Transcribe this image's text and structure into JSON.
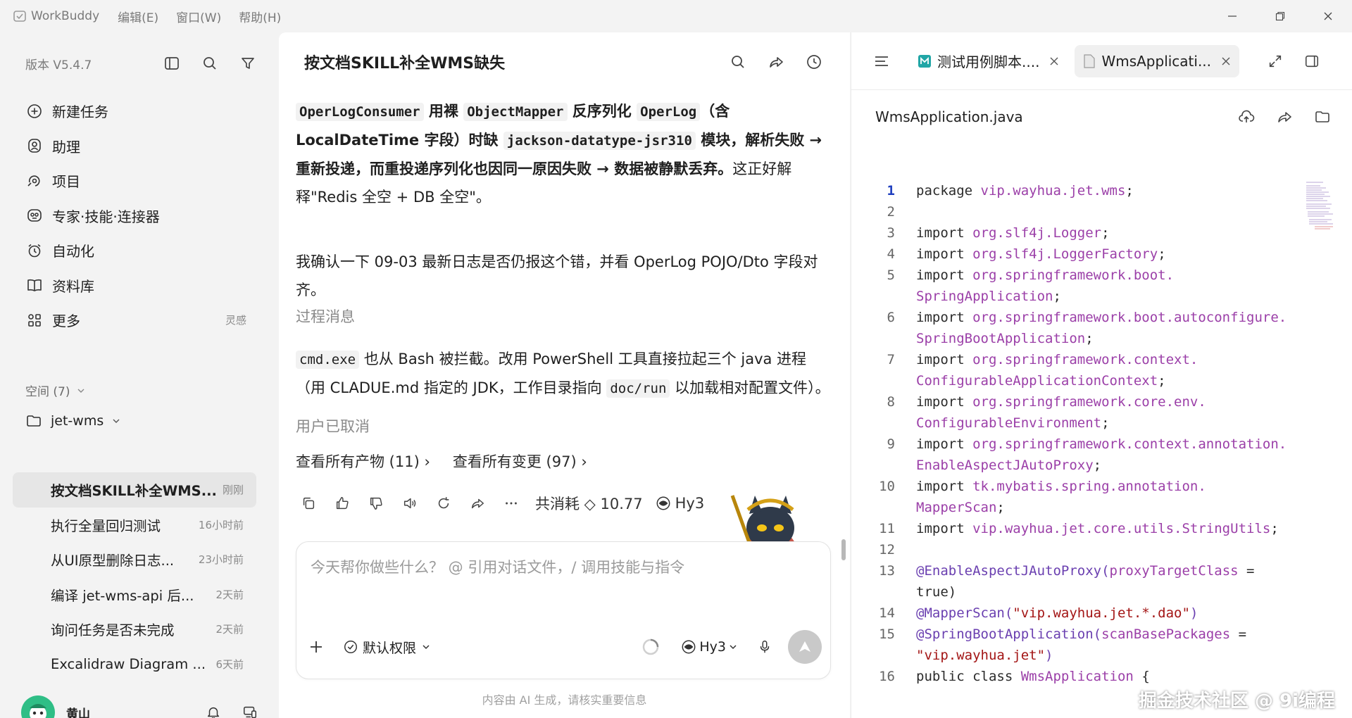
{
  "titlebar": {
    "app_name": "WorkBuddy",
    "menus": [
      "编辑(E)",
      "窗口(W)",
      "帮助(H)"
    ]
  },
  "sidebar": {
    "version": "版本 V5.4.7",
    "nav": [
      {
        "label": "新建任务",
        "icon": "plus-circle-icon"
      },
      {
        "label": "助理",
        "icon": "assistant-icon"
      },
      {
        "label": "项目",
        "icon": "project-icon"
      },
      {
        "label": "专家·技能·连接器",
        "icon": "expert-icon"
      },
      {
        "label": "自动化",
        "icon": "alarm-clock-icon"
      },
      {
        "label": "资料库",
        "icon": "book-icon"
      },
      {
        "label": "更多",
        "icon": "grid-icon",
        "tag": "灵感"
      }
    ],
    "space_label": "空间 (7)",
    "project": "jet-wms",
    "tasks": [
      {
        "title": "按文档SKILL补全WMS...",
        "time": "刚刚"
      },
      {
        "title": "执行全量回归测试",
        "time": "16小时前"
      },
      {
        "title": "从UI原型删除日志...",
        "time": "23小时前"
      },
      {
        "title": "编译 jet-wms-api 后...",
        "time": "2天前"
      },
      {
        "title": "询问任务是否未完成",
        "time": "2天前"
      },
      {
        "title": "Excalidraw Diagram ...",
        "time": "6天前"
      }
    ],
    "user_name": "黄山"
  },
  "chat": {
    "title": "按文档SKILL补全WMS缺失",
    "p1": {
      "c1": "OperLogConsumer",
      "t1": " 用裸 ",
      "c2": "ObjectMapper",
      "t2": " 反序列化 ",
      "c3": "OperLog",
      "t3": "（含 LocalDateTime 字段）时缺 ",
      "c4": "jackson-datatype-jsr310",
      "t4": " 模块，解析失败 → 重新投递，而重投递序列化也因同一原因失败 → 数据被静默丢弃。",
      "t5": "这正好解释\"Redis 全空 + DB 全空\"。"
    },
    "p2": "我确认一下 09-03 最新日志是否仍报这个错，并看 OperLog POJO/Dto 字段对齐。",
    "process_label": "过程消息",
    "p3": {
      "c1": "cmd.exe",
      "t1": " 也从 Bash 被拦截。改用 PowerShell 工具直接拉起三个 java 进程（用 CLADUE.md 指定的 JDK，工作目录指向 ",
      "c2": "doc/run",
      "t2": " 以加载相对配置文件）。"
    },
    "cancelled": "用户已取消",
    "link_artifacts": "查看所有产物 (11)",
    "link_changes": "查看所有变更 (97)",
    "cost_label": "共消耗",
    "cost_value": "10.77",
    "model": "Hy3",
    "input_placeholder": "今天帮你做些什么？ @ 引用对话文件，/ 调用技能与指令",
    "permission": "默认权限",
    "composer_model": "Hy3",
    "disclaimer": "内容由 AI 生成，请核实重要信息"
  },
  "codepanel": {
    "tabs": [
      {
        "label": "测试用例脚本....",
        "icon": "markdown-file-icon"
      },
      {
        "label": "WmsApplicati...",
        "icon": "file-icon"
      }
    ],
    "file_name": "WmsApplication.java",
    "lines": [
      {
        "n": "1",
        "parts": [
          [
            "kw",
            "package "
          ],
          [
            "pk",
            "vip.wayhua.jet.wms"
          ],
          [
            "kw",
            ";"
          ]
        ]
      },
      {
        "n": "2",
        "parts": [
          [
            "kw",
            ""
          ]
        ]
      },
      {
        "n": "3",
        "parts": [
          [
            "kw",
            "import "
          ],
          [
            "pk",
            "org.slf4j.Logger"
          ],
          [
            "kw",
            ";"
          ]
        ]
      },
      {
        "n": "4",
        "parts": [
          [
            "kw",
            "import "
          ],
          [
            "pk",
            "org.slf4j.LoggerFactory"
          ],
          [
            "kw",
            ";"
          ]
        ]
      },
      {
        "n": "5",
        "parts": [
          [
            "kw",
            "import "
          ],
          [
            "pk",
            "org.springframework.boot.\nSpringApplication"
          ],
          [
            "kw",
            ";"
          ]
        ]
      },
      {
        "n": "6",
        "parts": [
          [
            "kw",
            "import "
          ],
          [
            "pk",
            "org.springframework.boot.autoconfigure.\nSpringBootApplication"
          ],
          [
            "kw",
            ";"
          ]
        ]
      },
      {
        "n": "7",
        "parts": [
          [
            "kw",
            "import "
          ],
          [
            "pk",
            "org.springframework.context.\nConfigurableApplicationContext"
          ],
          [
            "kw",
            ";"
          ]
        ]
      },
      {
        "n": "8",
        "parts": [
          [
            "kw",
            "import "
          ],
          [
            "pk",
            "org.springframework.core.env.\nConfigurableEnvironment"
          ],
          [
            "kw",
            ";"
          ]
        ]
      },
      {
        "n": "9",
        "parts": [
          [
            "kw",
            "import "
          ],
          [
            "pk",
            "org.springframework.context.annotation.\nEnableAspectJAutoProxy"
          ],
          [
            "kw",
            ";"
          ]
        ]
      },
      {
        "n": "10",
        "parts": [
          [
            "kw",
            "import "
          ],
          [
            "pk",
            "tk.mybatis.spring.annotation.\nMapperScan"
          ],
          [
            "kw",
            ";"
          ]
        ]
      },
      {
        "n": "11",
        "parts": [
          [
            "kw",
            "import "
          ],
          [
            "pk",
            "vip.wayhua.jet.core.utils.StringUtils"
          ],
          [
            "kw",
            ";"
          ]
        ]
      },
      {
        "n": "12",
        "parts": [
          [
            "kw",
            ""
          ]
        ]
      },
      {
        "n": "13",
        "parts": [
          [
            "an",
            "@EnableAspectJAutoProxy("
          ],
          [
            "pk",
            "proxyTargetClass"
          ],
          [
            "kw",
            " =\ntrue)"
          ]
        ]
      },
      {
        "n": "14",
        "parts": [
          [
            "an",
            "@MapperScan("
          ],
          [
            "st",
            "\"vip.wayhua.jet.*.dao\""
          ],
          [
            "an",
            ")"
          ]
        ]
      },
      {
        "n": "15",
        "parts": [
          [
            "an",
            "@SpringBootApplication("
          ],
          [
            "pk",
            "scanBasePackages"
          ],
          [
            "kw",
            " =\n"
          ],
          [
            "st",
            "\"vip.wayhua.jet\""
          ],
          [
            "an",
            ")"
          ]
        ]
      },
      {
        "n": "16",
        "parts": [
          [
            "kw",
            "public class "
          ],
          [
            "pk",
            "WmsApplication"
          ],
          [
            "kw",
            " {"
          ]
        ]
      }
    ]
  },
  "watermark": "掘金技术社区 @ 9i编程",
  "colors": {
    "accent": "#1f3fbf",
    "sidebar_bg": "#f3f3f3",
    "active_task_bg": "#e6e6e6",
    "avatar": "#2fbe86"
  }
}
